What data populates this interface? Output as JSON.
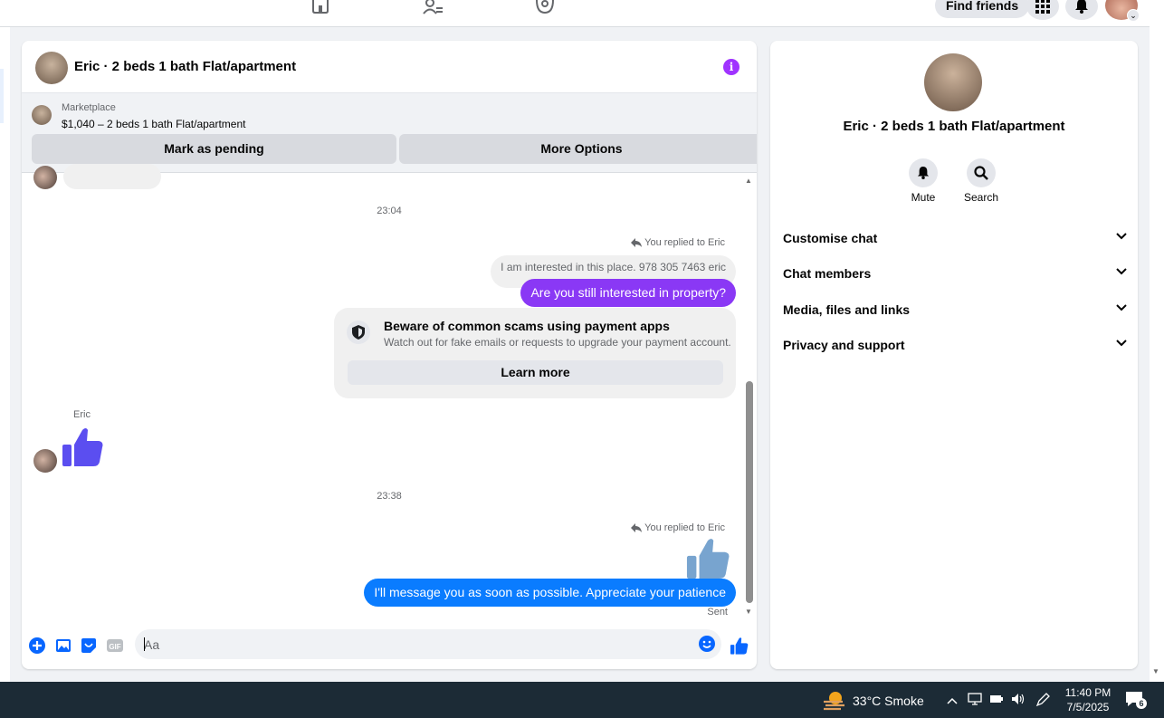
{
  "topbar": {
    "find_friends": "Find friends"
  },
  "chat": {
    "title": "Eric · 2 beds 1 bath Flat/apartment",
    "marketplace": {
      "label": "Marketplace",
      "listing": "$1,040 – 2 beds 1 bath Flat/apartment",
      "mark_pending": "Mark as pending",
      "more_options": "More Options"
    },
    "messages": {
      "time1": "23:04",
      "replied1": "You replied to Eric",
      "quoted1": "I am interested in this place. 978 305 7463 eric",
      "reply1": "Are you still interested in property?",
      "scam_title": "Beware of common scams using payment apps",
      "scam_sub": "Watch out for fake emails or requests to upgrade your payment account.",
      "learn_more": "Learn more",
      "sender_name": "Eric",
      "time2": "23:38",
      "replied2": "You replied to Eric",
      "reply2": "I'll message you as soon as possible. Appreciate your patience",
      "sent": "Sent"
    },
    "composer": {
      "placeholder": "Aa"
    }
  },
  "right_panel": {
    "name": "Eric · 2 beds 1 bath Flat/apartment",
    "mute": "Mute",
    "search": "Search",
    "sections": [
      "Customise chat",
      "Chat members",
      "Media, files and links",
      "Privacy and support"
    ]
  },
  "taskbar": {
    "weather": "33°C  Smoke",
    "time": "11:40 PM",
    "date": "7/5/2025",
    "notif_count": "6"
  },
  "colors": {
    "accent_purple": "#8a38f5",
    "accent_blue": "#0a7cff",
    "thumb_purple": "#5b4ef0",
    "icon_blue": "#0866ff",
    "info_purple": "#a033ff"
  }
}
